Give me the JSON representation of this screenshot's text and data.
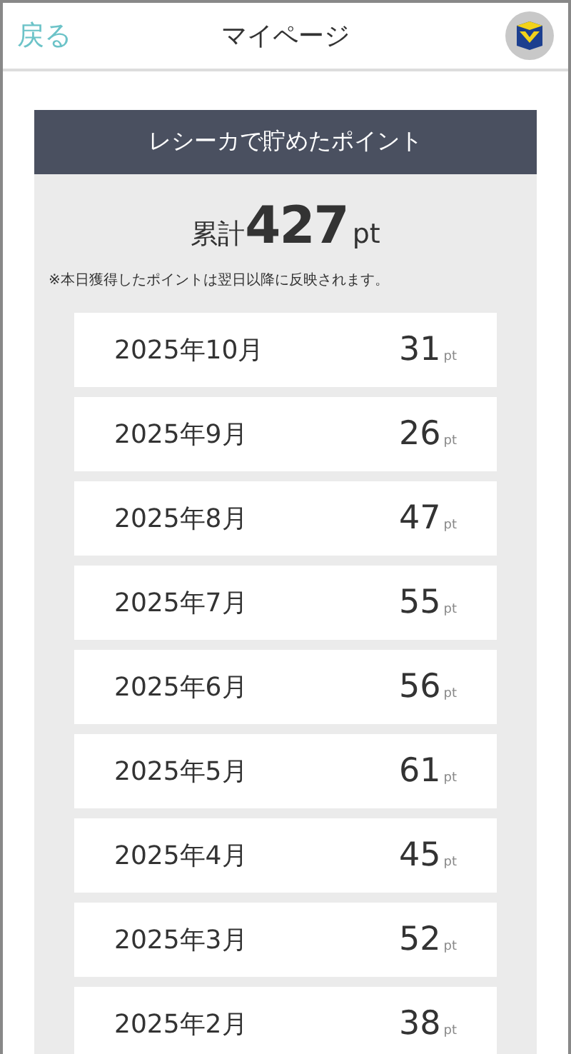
{
  "header": {
    "back": "戻る",
    "title": "マイページ"
  },
  "panel": {
    "title": "レシーカで貯めたポイント",
    "total_label": "累計",
    "total_value": "427",
    "total_unit": "pt",
    "note": "※本日獲得したポイントは翌日以降に反映されます。",
    "months": [
      {
        "month": "2025年10月",
        "points": "31",
        "unit": "pt"
      },
      {
        "month": "2025年9月",
        "points": "26",
        "unit": "pt"
      },
      {
        "month": "2025年8月",
        "points": "47",
        "unit": "pt"
      },
      {
        "month": "2025年7月",
        "points": "55",
        "unit": "pt"
      },
      {
        "month": "2025年6月",
        "points": "56",
        "unit": "pt"
      },
      {
        "month": "2025年5月",
        "points": "61",
        "unit": "pt"
      },
      {
        "month": "2025年4月",
        "points": "45",
        "unit": "pt"
      },
      {
        "month": "2025年3月",
        "points": "52",
        "unit": "pt"
      },
      {
        "month": "2025年2月",
        "points": "38",
        "unit": "pt"
      }
    ]
  }
}
